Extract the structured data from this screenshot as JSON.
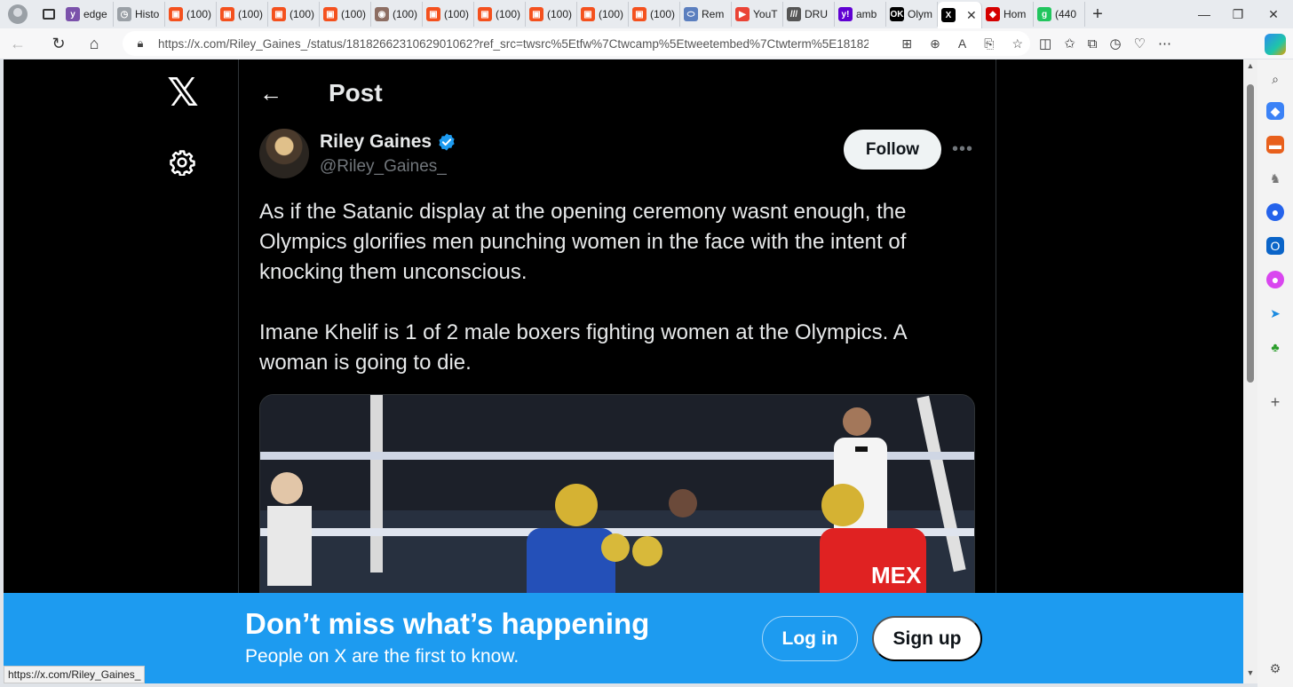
{
  "browser": {
    "tabs": [
      {
        "label": "edge",
        "color": "#7b52ab",
        "glyph": "y"
      },
      {
        "label": "Histo",
        "color": "#9aa0a6",
        "glyph": "◷"
      },
      {
        "label": "(100)",
        "color": "#f4511e",
        "glyph": "▣"
      },
      {
        "label": "(100)",
        "color": "#f4511e",
        "glyph": "▣"
      },
      {
        "label": "(100)",
        "color": "#f4511e",
        "glyph": "▣"
      },
      {
        "label": "(100)",
        "color": "#f4511e",
        "glyph": "▣"
      },
      {
        "label": "(100)",
        "color": "#8d6e63",
        "glyph": "◉"
      },
      {
        "label": "(100)",
        "color": "#f4511e",
        "glyph": "▣"
      },
      {
        "label": "(100)",
        "color": "#f4511e",
        "glyph": "▣"
      },
      {
        "label": "(100)",
        "color": "#f4511e",
        "glyph": "▣"
      },
      {
        "label": "(100)",
        "color": "#f4511e",
        "glyph": "▣"
      },
      {
        "label": "(100)",
        "color": "#f4511e",
        "glyph": "▣"
      },
      {
        "label": "Rem",
        "color": "#5b7fbf",
        "glyph": "⬭"
      },
      {
        "label": "YouT",
        "color": "#ea4335",
        "glyph": "▶"
      },
      {
        "label": "DRU",
        "color": "#555555",
        "glyph": "///"
      },
      {
        "label": "amb",
        "color": "#6001d2",
        "glyph": "y!"
      },
      {
        "label": "Olym",
        "color": "#000000",
        "glyph": "OK"
      },
      {
        "label": "",
        "color": "#000000",
        "glyph": "X",
        "active": true
      },
      {
        "label": "Hom",
        "color": "#d50000",
        "glyph": "◆"
      },
      {
        "label": "(440",
        "color": "#22c55e",
        "glyph": "g"
      }
    ],
    "url": "https://x.com/Riley_Gaines_/status/1818266231062901062?ref_src=twsrc%5Etfw%7Ctwcamp%5Etweetembed%7Ctwterm%5E18182...",
    "status_url": "https://x.com/Riley_Gaines_"
  },
  "page": {
    "title": "Post",
    "author": {
      "name": "Riley Gaines",
      "handle": "@Riley_Gaines_"
    },
    "follow_label": "Follow",
    "tweet_paragraphs": [
      "As if the Satanic display at the opening ceremony wasnt enough, the Olympics glorifies men punching women in the face with the intent of knocking them unconscious.",
      "Imane Khelif is 1 of 2 male boxers fighting women at the Olympics. A woman is going to die."
    ],
    "media_text": "MEX"
  },
  "banner": {
    "title": "Don’t miss what’s happening",
    "subtitle": "People on X are the first to know.",
    "login_label": "Log in",
    "signup_label": "Sign up"
  },
  "colors": {
    "accent": "#1d9bf0",
    "background": "#000000",
    "text": "#e7e9ea",
    "muted": "#71767b"
  }
}
